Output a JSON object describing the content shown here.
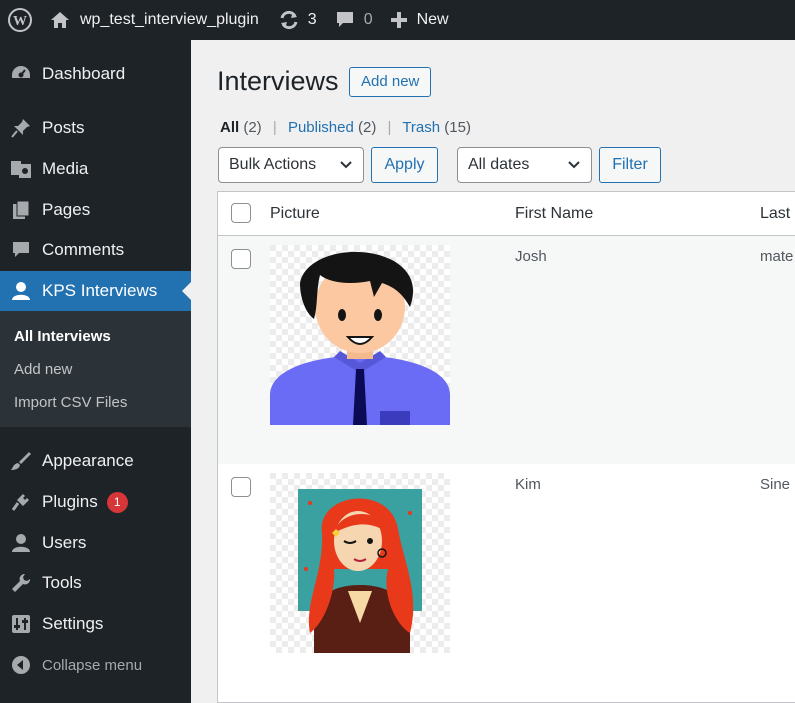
{
  "admin_bar": {
    "site_name": "wp_test_interview_plugin",
    "updates_count": "3",
    "comments_count": "0",
    "new_label": "New"
  },
  "sidebar": {
    "items": [
      {
        "label": "Dashboard",
        "icon": "dashboard-icon"
      },
      {
        "label": "Posts",
        "icon": "pin-icon"
      },
      {
        "label": "Media",
        "icon": "media-icon"
      },
      {
        "label": "Pages",
        "icon": "pages-icon"
      },
      {
        "label": "Comments",
        "icon": "comment-icon"
      },
      {
        "label": "KPS Interviews",
        "icon": "user-icon"
      },
      {
        "label": "Appearance",
        "icon": "brush-icon"
      },
      {
        "label": "Plugins",
        "icon": "plug-icon",
        "badge": "1"
      },
      {
        "label": "Users",
        "icon": "users-icon"
      },
      {
        "label": "Tools",
        "icon": "wrench-icon"
      },
      {
        "label": "Settings",
        "icon": "settings-icon"
      }
    ],
    "submenu": [
      "All Interviews",
      "Add new",
      "Import CSV Files"
    ],
    "collapse_label": "Collapse menu"
  },
  "main": {
    "title": "Interviews",
    "add_new": "Add new",
    "views": {
      "all": "All",
      "all_count": "(2)",
      "published": "Published",
      "published_count": "(2)",
      "trash": "Trash",
      "trash_count": "(15)",
      "separator": "|"
    },
    "bulk_actions": "Bulk Actions",
    "apply": "Apply",
    "dates": "All dates",
    "filter": "Filter"
  },
  "table": {
    "columns": [
      "Picture",
      "First Name",
      "Last"
    ],
    "rows": [
      {
        "first_name": "Josh",
        "last_name": "mate"
      },
      {
        "first_name": "Kim",
        "last_name": "Sine"
      }
    ]
  },
  "colors": {
    "admin_bg": "#1d2327",
    "accent": "#2271b1",
    "badge": "#d63638"
  }
}
